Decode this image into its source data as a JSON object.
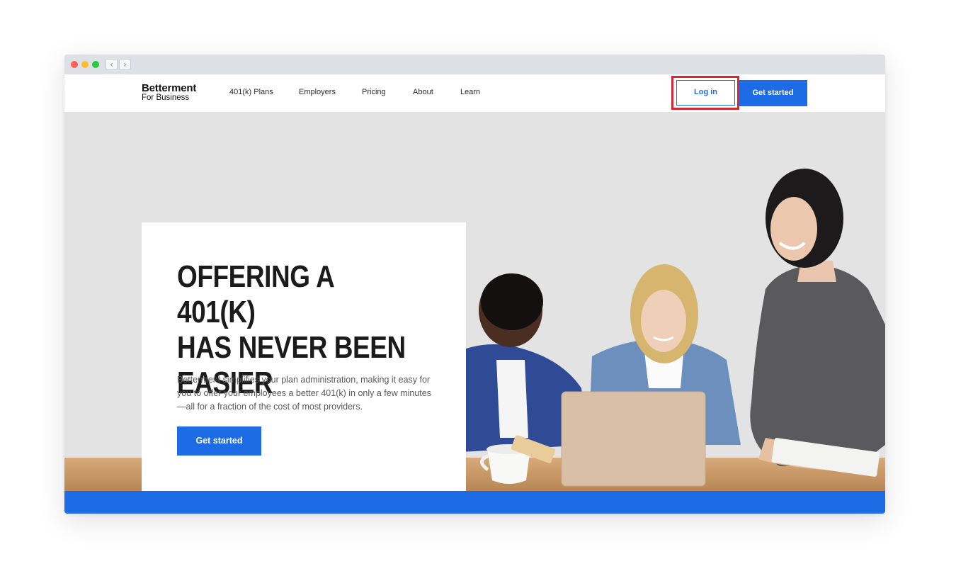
{
  "browser": {
    "back_icon": "chevron-left-icon",
    "forward_icon": "chevron-right-icon",
    "back_glyph": "‹",
    "forward_glyph": "›"
  },
  "header": {
    "logo_line1": "Betterment",
    "logo_line2": "For Business",
    "nav": [
      "401(k) Plans",
      "Employers",
      "Pricing",
      "About",
      "Learn"
    ],
    "login_label": "Log in",
    "get_started_label": "Get started"
  },
  "hero": {
    "headline": "OFFERING A 401(K)\nHAS NEVER BEEN\nEASIER",
    "description": "Betterment simplifies your plan administration, making it easy for you to offer your employees a better 401(k) in only a few minutes—all for a fraction of the cost of most providers.",
    "cta_label": "Get started"
  },
  "colors": {
    "accent": "#1e6be6",
    "highlight": "#d7282f",
    "hero_bg": "#e3e3e3"
  }
}
